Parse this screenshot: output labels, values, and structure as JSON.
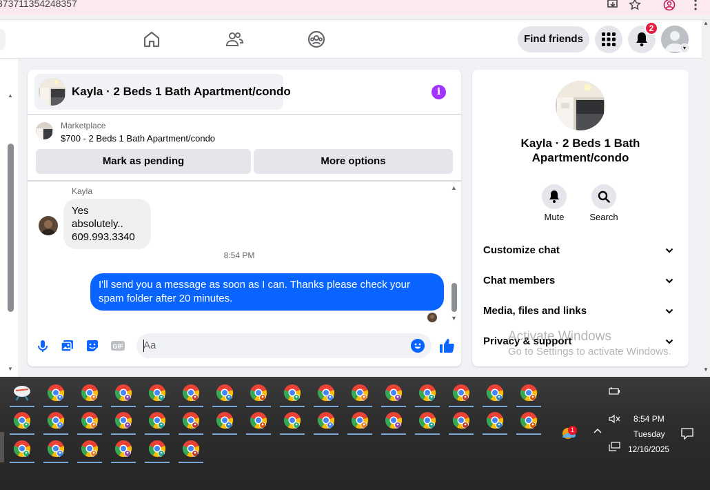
{
  "browser": {
    "url_fragment": "373711354248357"
  },
  "topnav": {
    "find_friends": "Find friends",
    "notification_count": "2"
  },
  "chat": {
    "title": "Kayla · 2 Beds 1 Bath Apartment/condo",
    "marketplace_label": "Marketplace",
    "listing": "$700 - 2 Beds 1 Bath Apartment/condo",
    "mark_pending": "Mark as pending",
    "more_options": "More options",
    "messages": {
      "sender_name": "Kayla",
      "incoming_line1": "Yes absolutely..",
      "incoming_line2": "609.993.3340",
      "timestamp": "8:54 PM",
      "outgoing": "I'll send you a message as soon as I can. Thanks please check your spam folder after 20 minutes."
    },
    "composer": {
      "placeholder": "Aa"
    }
  },
  "details": {
    "name": "Kayla · 2 Beds 1 Bath Apartment/condo",
    "mute_label": "Mute",
    "search_label": "Search",
    "sections": [
      "Customize chat",
      "Chat members",
      "Media, files and links",
      "Privacy & support"
    ]
  },
  "watermark": {
    "line1": "Activate Windows",
    "line2": "Go to Settings to activate Windows."
  },
  "taskbar": {
    "time": "8:54 PM",
    "day": "Tuesday",
    "date": "12/16/2025",
    "weather_badge": "1"
  },
  "colors": {
    "messenger_blue": "#0a64ff",
    "info_purple": "#a033ff",
    "badge_red": "#e41e3f"
  }
}
